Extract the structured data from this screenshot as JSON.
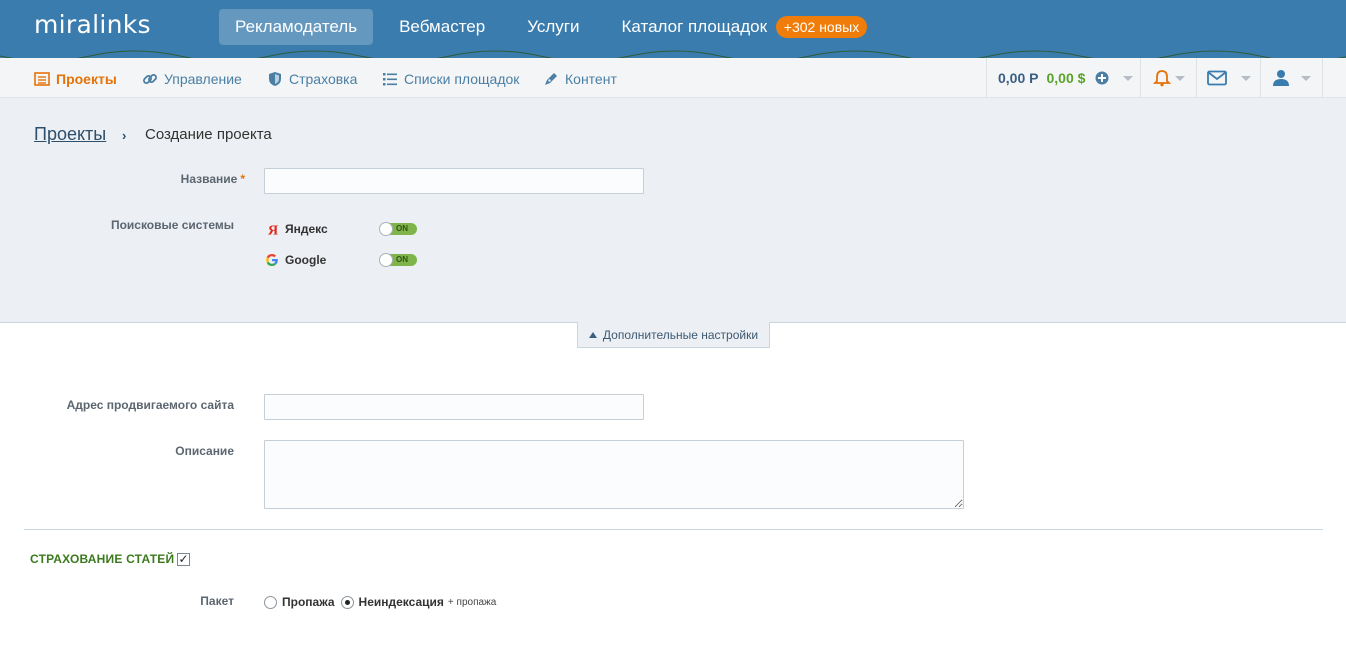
{
  "app": {
    "logo": "miralinks"
  },
  "topnav": {
    "items": [
      {
        "label": "Рекламодатель",
        "active": true
      },
      {
        "label": "Вебмастер"
      },
      {
        "label": "Услуги"
      },
      {
        "label": "Каталог площадок"
      }
    ],
    "badge": "+302 новых"
  },
  "subnav": {
    "items": [
      {
        "label": "Проекты",
        "icon": "list-icon",
        "active": true
      },
      {
        "label": "Управление",
        "icon": "link-icon"
      },
      {
        "label": "Страховка",
        "icon": "shield-icon"
      },
      {
        "label": "Списки площадок",
        "icon": "bullet-list-icon"
      },
      {
        "label": "Контент",
        "icon": "pen-icon"
      }
    ],
    "balance_rub": "0,00 Р",
    "balance_usd": "0,00 $",
    "icons": [
      "plus-circle-icon",
      "bell-icon",
      "envelope-icon",
      "user-icon"
    ]
  },
  "breadcrumb": {
    "root": "Проекты",
    "separator": "›",
    "current": "Создание проекта"
  },
  "form": {
    "name_label": "Название",
    "required_mark": "*",
    "name_value": "",
    "search_label": "Поисковые системы",
    "engines": [
      {
        "name": "Яндекс",
        "icon": "yandex-icon",
        "toggle": "ON",
        "enabled": true
      },
      {
        "name": "Google",
        "icon": "google-icon",
        "toggle": "ON",
        "enabled": true
      }
    ],
    "advanced_label": "Дополнительные настройки",
    "site_label": "Адрес продвигаемого сайта",
    "site_value": "",
    "desc_label": "Описание",
    "desc_value": ""
  },
  "insurance": {
    "title": "СТРАХОВАНИЕ СТАТЕЙ",
    "checked": true,
    "package_label": "Пакет",
    "options": [
      {
        "label": "Пропажа",
        "selected": false
      },
      {
        "label": "Неиндексация",
        "note": "+ пропажа",
        "selected": true
      }
    ]
  },
  "colors": {
    "header": "#3a7cad",
    "accent": "#e4730a",
    "link": "#4a7fa3",
    "toggle_on": "#7fb44a",
    "section_green": "#3b7a1e"
  }
}
